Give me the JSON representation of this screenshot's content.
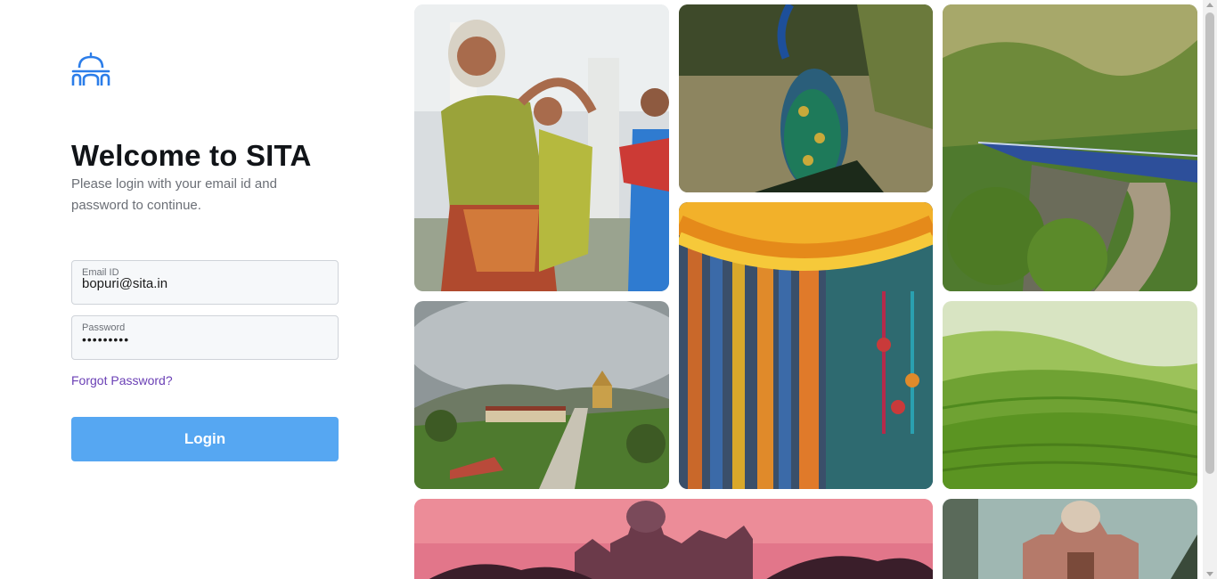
{
  "brand": {
    "logo_icon": "palace-dome-icon",
    "accent": "#2b7de9"
  },
  "login": {
    "title": "Welcome to SITA",
    "subtitle": "Please login with your email id and password to continue.",
    "email": {
      "label": "Email ID",
      "value": "bopuri@sita.in"
    },
    "password": {
      "label": "Password",
      "value": "•••••••••"
    },
    "forgot_label": "Forgot Password?",
    "login_label": "Login",
    "button_color": "#56a7f2",
    "link_color": "#6a3fb5"
  },
  "gallery": {
    "images": [
      "dancers-photo",
      "peacock-photo",
      "train-hills-photo",
      "monastery-photo",
      "marigold-garland-photo",
      "tea-garden-photo",
      "victoria-memorial-photo",
      "tomb-photo"
    ]
  }
}
